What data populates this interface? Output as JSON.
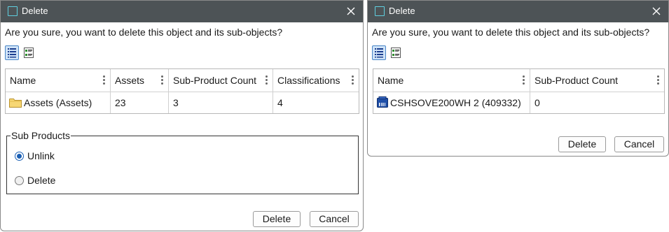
{
  "dialogs": [
    {
      "title": "Delete",
      "prompt": "Are you sure, you want to delete this object and its sub-objects?",
      "view_modes": [
        "list-view-icon",
        "detail-view-icon"
      ],
      "grid": {
        "columns": [
          "Name",
          "Assets",
          "Sub-Product Count",
          "Classifications"
        ],
        "rows": [
          {
            "icon": "folder-icon",
            "name": "Assets (Assets)",
            "assets": "23",
            "sub_product_count": "3",
            "classifications": "4"
          }
        ]
      },
      "sub_products": {
        "legend": "Sub Products",
        "options": [
          {
            "label": "Unlink",
            "checked": true
          },
          {
            "label": "Delete",
            "checked": false
          }
        ]
      },
      "buttons": {
        "delete": "Delete",
        "cancel": "Cancel"
      }
    },
    {
      "title": "Delete",
      "prompt": "Are you sure, you want to delete this object and its sub-objects?",
      "view_modes": [
        "list-view-icon",
        "detail-view-icon"
      ],
      "grid": {
        "columns": [
          "Name",
          "Sub-Product Count"
        ],
        "rows": [
          {
            "icon": "product-icon",
            "name": "CSHSOVE200WH 2 (409332)",
            "sub_product_count": "0"
          }
        ]
      },
      "buttons": {
        "delete": "Delete",
        "cancel": "Cancel"
      }
    }
  ],
  "colors": {
    "titlebar": "#4d5356",
    "title_icon": "#5fd0e0",
    "selection_accent": "#1a5fb4",
    "active_view_bg": "#cfe3f7"
  }
}
